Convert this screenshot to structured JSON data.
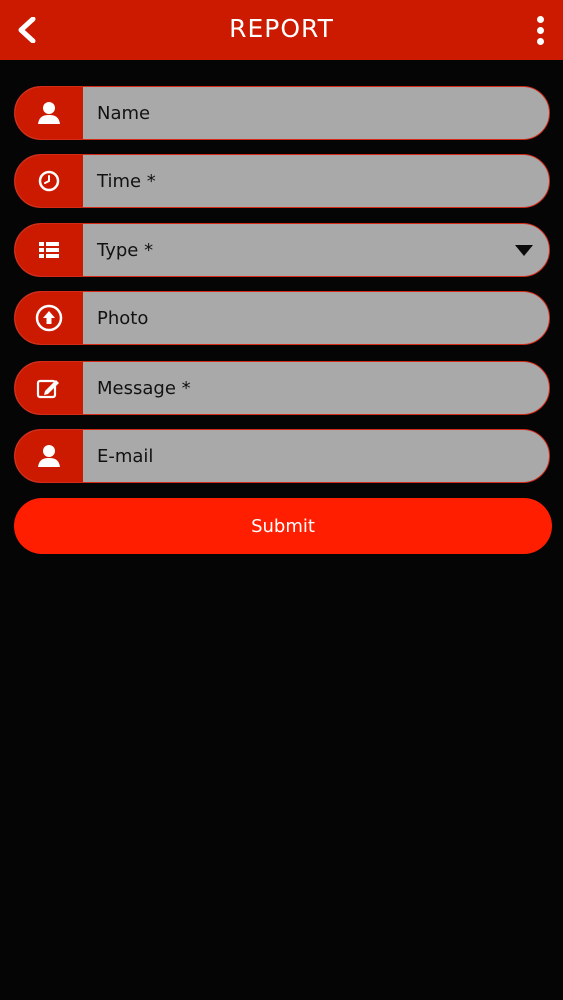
{
  "header": {
    "title": "REPORT",
    "back_icon": "chevron-left-icon",
    "menu_icon": "more-vertical-icon",
    "color": "#cc1a00"
  },
  "form": {
    "fields": [
      {
        "label": "Name",
        "icon": "user-icon"
      },
      {
        "label": "Time *",
        "icon": "clock-icon"
      },
      {
        "label": "Type *",
        "icon": "list-icon",
        "dropdown": true
      },
      {
        "label": "Photo",
        "icon": "upload-icon"
      },
      {
        "label": "Message *",
        "icon": "edit-icon"
      },
      {
        "label": "E-mail",
        "icon": "user-icon"
      }
    ],
    "submit_label": "Submit",
    "accent": "#ff1f00",
    "field_bg": "#a9a9a9"
  }
}
